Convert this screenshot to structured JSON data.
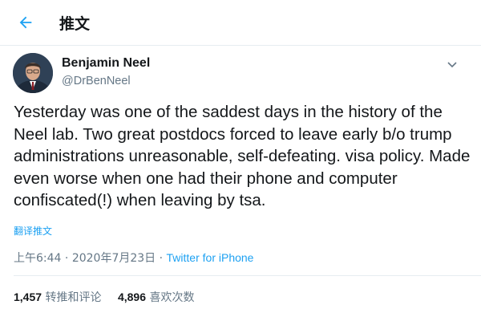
{
  "header": {
    "title": "推文",
    "back_icon": "back-arrow-icon"
  },
  "tweet": {
    "author_name": "Benjamin Neel",
    "author_handle": "@DrBenNeel",
    "text": "Yesterday was one of the saddest days in the history of the Neel lab. Two great postdocs forced to leave early b/o trump administrations unreasonable, self-defeating. visa policy. Made even worse when one had their phone and computer confiscated(!) when leaving by tsa.",
    "translate_label": "翻译推文",
    "time": "上午6:44",
    "date": "2020年7月23日",
    "separator": "·",
    "client": "Twitter for iPhone"
  },
  "stats": {
    "retweets_count": "1,457",
    "retweets_label": "转推和评论",
    "likes_count": "4,896",
    "likes_label": "喜欢次数"
  },
  "colors": {
    "accent": "#1da1f2",
    "text": "#14171a",
    "muted": "#657786",
    "border": "#e6ecf0"
  }
}
